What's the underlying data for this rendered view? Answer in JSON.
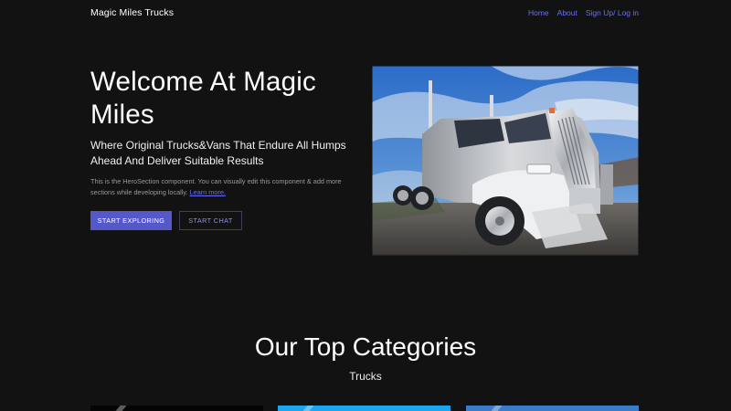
{
  "nav": {
    "brand": "Magic Miles Trucks",
    "links": [
      "Home",
      "About",
      "Sign Up/ Log in"
    ]
  },
  "hero": {
    "title": "Welcome At Magic Miles",
    "subtitle": "Where Original Trucks&Vans That Endure All Humps Ahead And Deliver Suitable Results",
    "description": "This is the HeroSection component. You can visually edit this component & add more sections while developing locally.",
    "link_text": "Learn more.",
    "primary_button": "START EXPLORING",
    "secondary_button": "START CHAT"
  },
  "categories": {
    "title": "Our Top Categories",
    "subtitle": "Trucks"
  },
  "colors": {
    "background": "#121212",
    "accent": "#5458c9",
    "link": "#6b6ff0"
  }
}
